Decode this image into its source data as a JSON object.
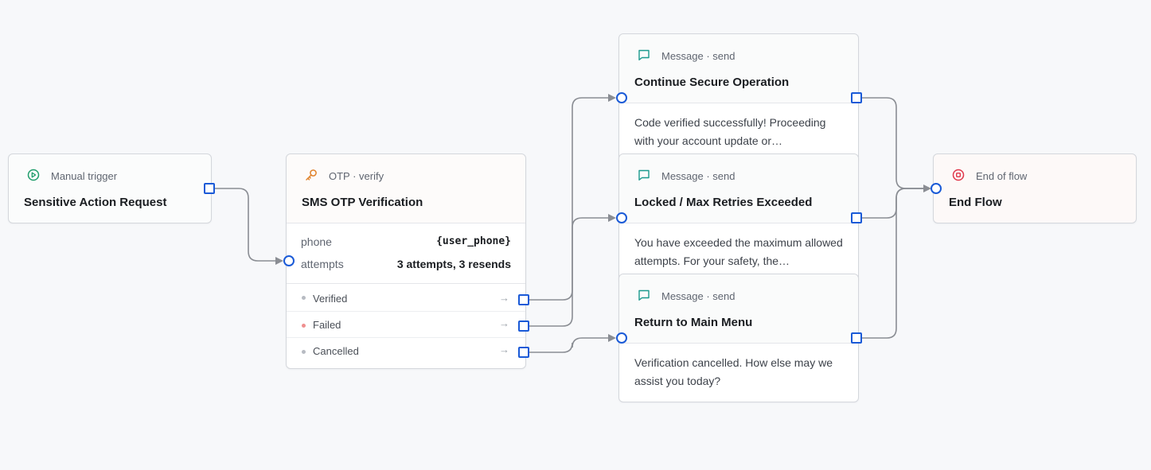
{
  "nodes": {
    "trigger": {
      "kind": "Manual trigger",
      "title": "Sensitive Action Request",
      "icon": "play-circle-icon"
    },
    "otp": {
      "kind": "OTP · verify",
      "title": "SMS OTP Verification",
      "icon": "key-icon",
      "params": [
        {
          "key": "phone",
          "value": "{user_phone}"
        },
        {
          "key": "attempts",
          "value": "3 attempts, 3 resends"
        }
      ],
      "outcomes": [
        {
          "label": "Verified",
          "status": "neutral"
        },
        {
          "label": "Failed",
          "status": "error"
        },
        {
          "label": "Cancelled",
          "status": "neutral"
        }
      ]
    },
    "msg_continue": {
      "kind": "Message · send",
      "title": "Continue Secure Operation",
      "icon": "message-icon",
      "body": "Code verified successfully! Proceeding with your account update or…"
    },
    "msg_locked": {
      "kind": "Message · send",
      "title": "Locked / Max Retries Exceeded",
      "icon": "message-icon",
      "body": "You have exceeded the maximum allowed attempts. For your safety, the…"
    },
    "msg_return": {
      "kind": "Message · send",
      "title": "Return to Main Menu",
      "icon": "message-icon",
      "body": "Verification cancelled. How else may we assist you today?"
    },
    "end": {
      "kind": "End of flow",
      "title": "End Flow",
      "icon": "stop-circle-icon"
    }
  },
  "colors": {
    "trigger_icon": "#1f9d6b",
    "otp_icon": "#e0822b",
    "message_icon": "#1b9a8e",
    "end_icon": "#e0364a",
    "port": "#1a5ad7",
    "edge": "#8a8d93"
  }
}
